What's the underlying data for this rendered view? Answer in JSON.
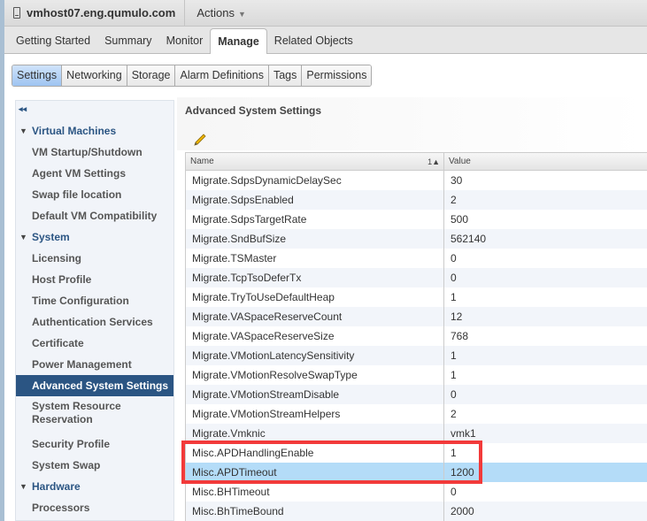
{
  "header": {
    "host": "vmhost07.eng.qumulo.com",
    "actions": "Actions"
  },
  "tabs": [
    "Getting Started",
    "Summary",
    "Monitor",
    "Manage",
    "Related Objects"
  ],
  "active_tab": "Manage",
  "subtabs": [
    "Settings",
    "Networking",
    "Storage",
    "Alarm Definitions",
    "Tags",
    "Permissions"
  ],
  "active_subtab": "Settings",
  "sidebar": {
    "collapse": "◂◂",
    "items": [
      {
        "label": "Virtual Machines",
        "type": "group"
      },
      {
        "label": "VM Startup/Shutdown"
      },
      {
        "label": "Agent VM Settings"
      },
      {
        "label": "Swap file location"
      },
      {
        "label": "Default VM Compatibility"
      },
      {
        "label": "System",
        "type": "group"
      },
      {
        "label": "Licensing"
      },
      {
        "label": "Host Profile"
      },
      {
        "label": "Time Configuration"
      },
      {
        "label": "Authentication Services"
      },
      {
        "label": "Certificate"
      },
      {
        "label": "Power Management"
      },
      {
        "label": "Advanced System Settings",
        "selected": true
      },
      {
        "label": "System Resource Reservation",
        "two": true
      },
      {
        "label": "Security Profile"
      },
      {
        "label": "System Swap"
      },
      {
        "label": "Hardware",
        "type": "group"
      },
      {
        "label": "Processors"
      }
    ]
  },
  "panel": {
    "title": "Advanced System Settings"
  },
  "table": {
    "columns": {
      "name": "Name",
      "sort": "1▲",
      "value": "Value"
    },
    "rows": [
      [
        "Migrate.SdpsDynamicDelaySec",
        "30"
      ],
      [
        "Migrate.SdpsEnabled",
        "2"
      ],
      [
        "Migrate.SdpsTargetRate",
        "500"
      ],
      [
        "Migrate.SndBufSize",
        "562140"
      ],
      [
        "Migrate.TSMaster",
        "0"
      ],
      [
        "Migrate.TcpTsoDeferTx",
        "0"
      ],
      [
        "Migrate.TryToUseDefaultHeap",
        "1"
      ],
      [
        "Migrate.VASpaceReserveCount",
        "12"
      ],
      [
        "Migrate.VASpaceReserveSize",
        "768"
      ],
      [
        "Migrate.VMotionLatencySensitivity",
        "1"
      ],
      [
        "Migrate.VMotionResolveSwapType",
        "1"
      ],
      [
        "Migrate.VMotionStreamDisable",
        "0"
      ],
      [
        "Migrate.VMotionStreamHelpers",
        "2"
      ],
      [
        "Migrate.Vmknic",
        "vmk1"
      ],
      [
        "Misc.APDHandlingEnable",
        "1"
      ],
      [
        "Misc.APDTimeout",
        "1200"
      ],
      [
        "Misc.BHTimeout",
        "0"
      ],
      [
        "Misc.BhTimeBound",
        "2000"
      ]
    ],
    "selected_row": 15
  },
  "colors": {
    "accent": "#2b5583",
    "selection": "#b4dcf8",
    "highlight_box": "#f23a3a"
  }
}
